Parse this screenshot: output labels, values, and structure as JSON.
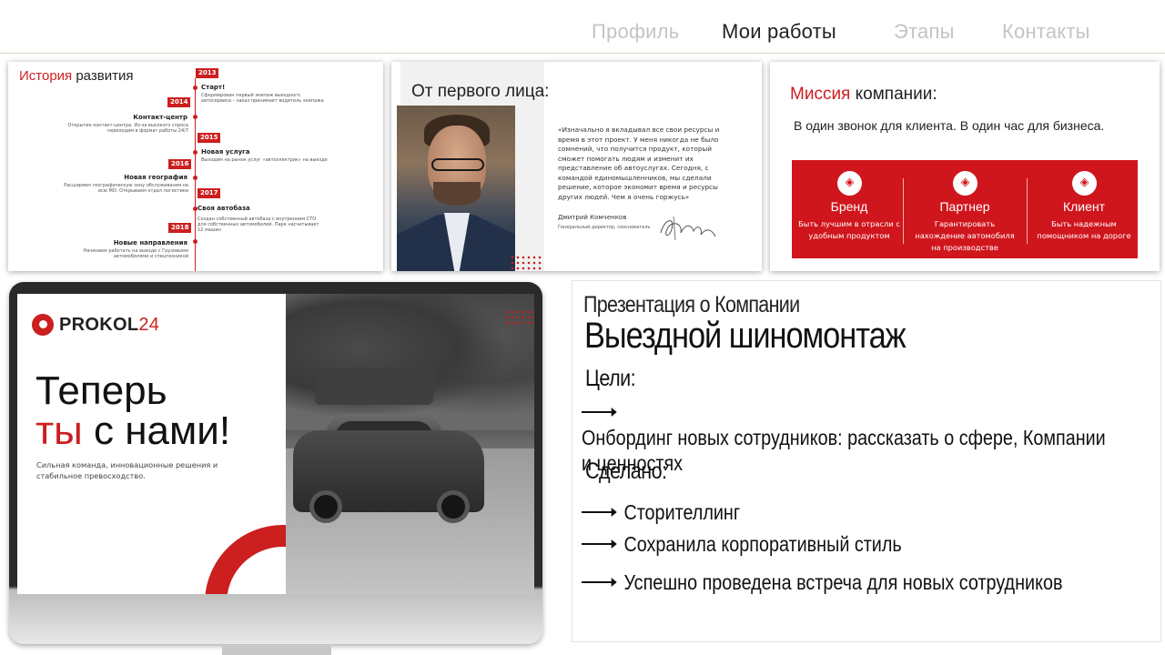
{
  "nav": {
    "items": [
      {
        "label": "Профиль",
        "active": false
      },
      {
        "label": "Мои работы",
        "active": true
      },
      {
        "label": "Этапы",
        "active": false
      },
      {
        "label": "Контакты",
        "active": false
      }
    ]
  },
  "history": {
    "title_accent": "История",
    "title_rest": " развития",
    "events": [
      {
        "year": "2013",
        "title": "Старт!",
        "desc": "Сформирован первый экипаж выездного автосервиса – заказ принимает водитель экипажа"
      },
      {
        "year": "2014",
        "title": "Контакт-центр",
        "desc": "Открытие контакт-центра. Из-за высокого спроса переходим в формат работы 24/7"
      },
      {
        "year": "2015",
        "title": "Новая услуга",
        "desc": "Выходим на рынок услуг «автоэлектрик» на выезде"
      },
      {
        "year": "2016",
        "title": "Новая география",
        "desc": "Расширяем географическую зону обслуживания на всю МО. Открываем отдел логистики"
      },
      {
        "year": "2017",
        "title": "Своя автобаза",
        "desc": "Создан собственный автобаза с внутренним СТО для собственных автомобилей. Парк насчитывает 12 машин"
      },
      {
        "year": "2018",
        "title": "Новые направления",
        "desc": "Начинаем работать на выезде с Грузовыми автомобилями и спецтехникой"
      }
    ]
  },
  "quote_slide": {
    "heading": "От первого лица:",
    "text": "«Изначально я вкладывал все свои ресурсы и время в этот проект. У меня никогда не было сомнений, что получится продукт, который сможет помогать людям и изменит их представление об автоуслугах. Сегодня, с командой единомышленников, мы сделали решение, которое экономит время и ресурсы других людей. Чем я очень горжусь»",
    "author_name": "Дмитрий Комченков",
    "author_role": "Генеральный директор, сооснователь"
  },
  "mission": {
    "heading_accent": "Миссия",
    "heading_rest": " компании:",
    "text": "В один звонок для клиента.  В один час для бизнеса.",
    "columns": [
      {
        "title": "Бренд",
        "desc": "Быть лучшим в отрасли с удобным продуктом"
      },
      {
        "title": "Партнер",
        "desc": "Гарантировать нахождение автомобиля на производстве"
      },
      {
        "title": "Клиент",
        "desc": "Быть надежным помощником на дороге"
      }
    ]
  },
  "cover": {
    "logo_text": "PROKOL",
    "logo_num": "24",
    "hero_line1": "Теперь",
    "hero_accent": "ты",
    "hero_rest": " с нами!",
    "subtitle": "Сильная команда, инновационные решения и стабильное превосходство."
  },
  "description": {
    "pre_title": "Презентация о Компании",
    "title": "Выездной шиномонтаж",
    "goals_label": "Цели:",
    "goals": [
      "Онбординг новых сотрудников: рассказать о сфере, Компании и ценностях"
    ],
    "done_label": "Сделано:",
    "done": [
      "Сторителлинг",
      "Сохранила корпоративный стиль",
      "Успешно проведена встреча для новых сотрудников"
    ]
  },
  "colors": {
    "accent": "#cc1f1f",
    "band": "#d0161d"
  },
  "icons": {
    "mission": "diamond-icon",
    "arrow": "arrow-right-icon"
  }
}
